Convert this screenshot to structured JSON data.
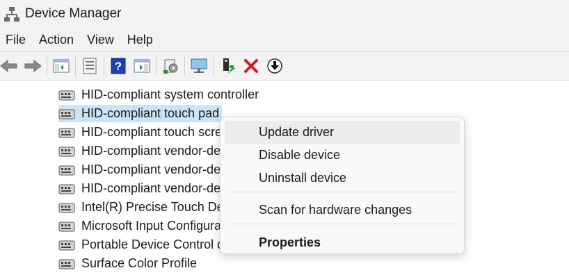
{
  "window": {
    "title": "Device Manager",
    "icon": "device-manager-icon"
  },
  "menu": [
    "File",
    "Action",
    "View",
    "Help"
  ],
  "toolbar": {
    "buttons": [
      "back-arrow-icon",
      "forward-arrow-icon",
      "show-hide-console-tree-icon",
      "properties-icon",
      "help-icon",
      "action-pane-icon",
      "scan-hardware-icon",
      "computer-icon",
      "update-driver-icon",
      "uninstall-icon",
      "disable-device-icon"
    ]
  },
  "tree": {
    "items": [
      "HID-compliant system controller",
      "HID-compliant touch pad",
      "HID-compliant touch scre",
      "HID-compliant vendor-de",
      "HID-compliant vendor-de",
      "HID-compliant vendor-de",
      "Intel(R) Precise Touch Dev",
      "Microsoft Input Configura",
      "Portable Device Control d",
      "Surface Color Profile"
    ],
    "selected_index": 1
  },
  "context_menu": {
    "items": [
      "Update driver",
      "Disable device",
      "Uninstall device",
      "Scan for hardware changes",
      "Properties"
    ],
    "highlighted": "Update driver",
    "bold": "Properties"
  },
  "colors": {
    "chrome_bg": "#f3f3f3",
    "selection": "#cce4f7",
    "delete_red": "#d21e1e",
    "help_blue": "#1f3fb3"
  }
}
